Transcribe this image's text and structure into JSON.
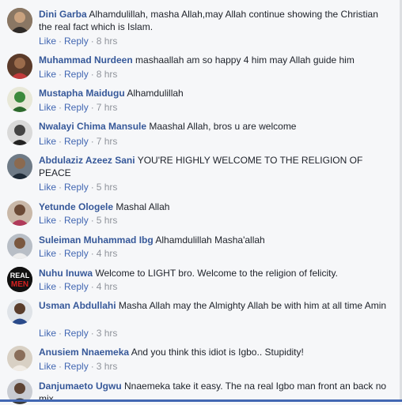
{
  "actions": {
    "like": "Like",
    "reply": "Reply",
    "separator": "·"
  },
  "comments": [
    {
      "author": "Dini Garba",
      "text": "Alhamdulillah, masha Allah,may Allah continue showing the Christian the real fact which is Islam.",
      "time": "8 hrs"
    },
    {
      "author": "Muhammad Nurdeen",
      "text": "mashaallah am so happy 4 him may Allah guide him",
      "time": "8 hrs"
    },
    {
      "author": "Mustapha Maidugu",
      "text": "Alhamdulillah",
      "time": "7 hrs"
    },
    {
      "author": "Nwalayi Chima Mansule",
      "text": "Maashal Allah, bros u are welcome",
      "time": "7 hrs"
    },
    {
      "author": "Abdulaziz Azeez Sani",
      "text": "YOU'RE HIGHLY WELCOME TO THE RELIGION OF PEACE",
      "time": "5 hrs"
    },
    {
      "author": "Yetunde Ologele",
      "text": "Mashal Allah",
      "time": "5 hrs"
    },
    {
      "author": "Suleiman Muhammad Ibg",
      "text": "Alhamdulillah Masha'allah",
      "time": "4 hrs"
    },
    {
      "author": "Nuhu Inuwa",
      "text": "Welcome to LIGHT bro. Welcome to the religion of felicity.",
      "time": "4 hrs",
      "avatar_text": "REAL MEN"
    },
    {
      "author": "Usman Abdullahi",
      "text": "Masha Allah may the Almighty Allah be with him at all time Amin",
      "time": "3 hrs"
    },
    {
      "author": "Anusiem Nnaemeka",
      "text": "And you think this idiot is Igbo.. Stupidity!",
      "time": "3 hrs"
    },
    {
      "author": "Danjumaeto Ugwu",
      "text": "Nnaemeka take it easy. The na real Igbo man front an back no mix",
      "time": ""
    }
  ],
  "colors": {
    "author": "#365899",
    "link": "#4267b2",
    "meta": "#90949c",
    "text": "#1d2129",
    "background": "#f6f7f9"
  }
}
